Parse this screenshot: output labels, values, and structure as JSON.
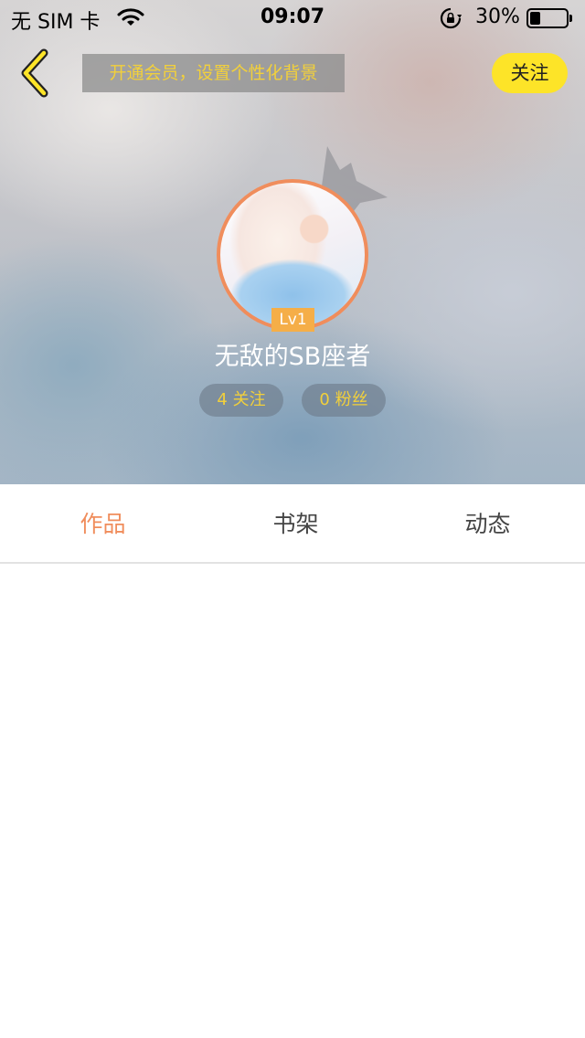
{
  "status_bar": {
    "carrier": "无 SIM 卡",
    "time": "09:07",
    "battery_text": "30%",
    "battery_level": 0.3,
    "icons": [
      "wifi-icon",
      "orientation-lock-icon",
      "battery-icon"
    ]
  },
  "header": {
    "back_icon": "chevron-left-icon",
    "vip_banner": "开通会员，设置个性化背景",
    "follow_label": "关注"
  },
  "profile": {
    "avatar_icon": "anime-girl-avatar",
    "level": "Lv1",
    "name": "无敌的SB座者",
    "following": "4 关注",
    "fans": "0 粉丝"
  },
  "tabs": [
    {
      "label": "作品",
      "active": true
    },
    {
      "label": "书架",
      "active": false
    },
    {
      "label": "动态",
      "active": false
    }
  ],
  "colors": {
    "accent_orange": "#f08d5c",
    "accent_yellow": "#fde428",
    "banner_text": "#f2d03b",
    "level_badge": "#f5ae48"
  }
}
